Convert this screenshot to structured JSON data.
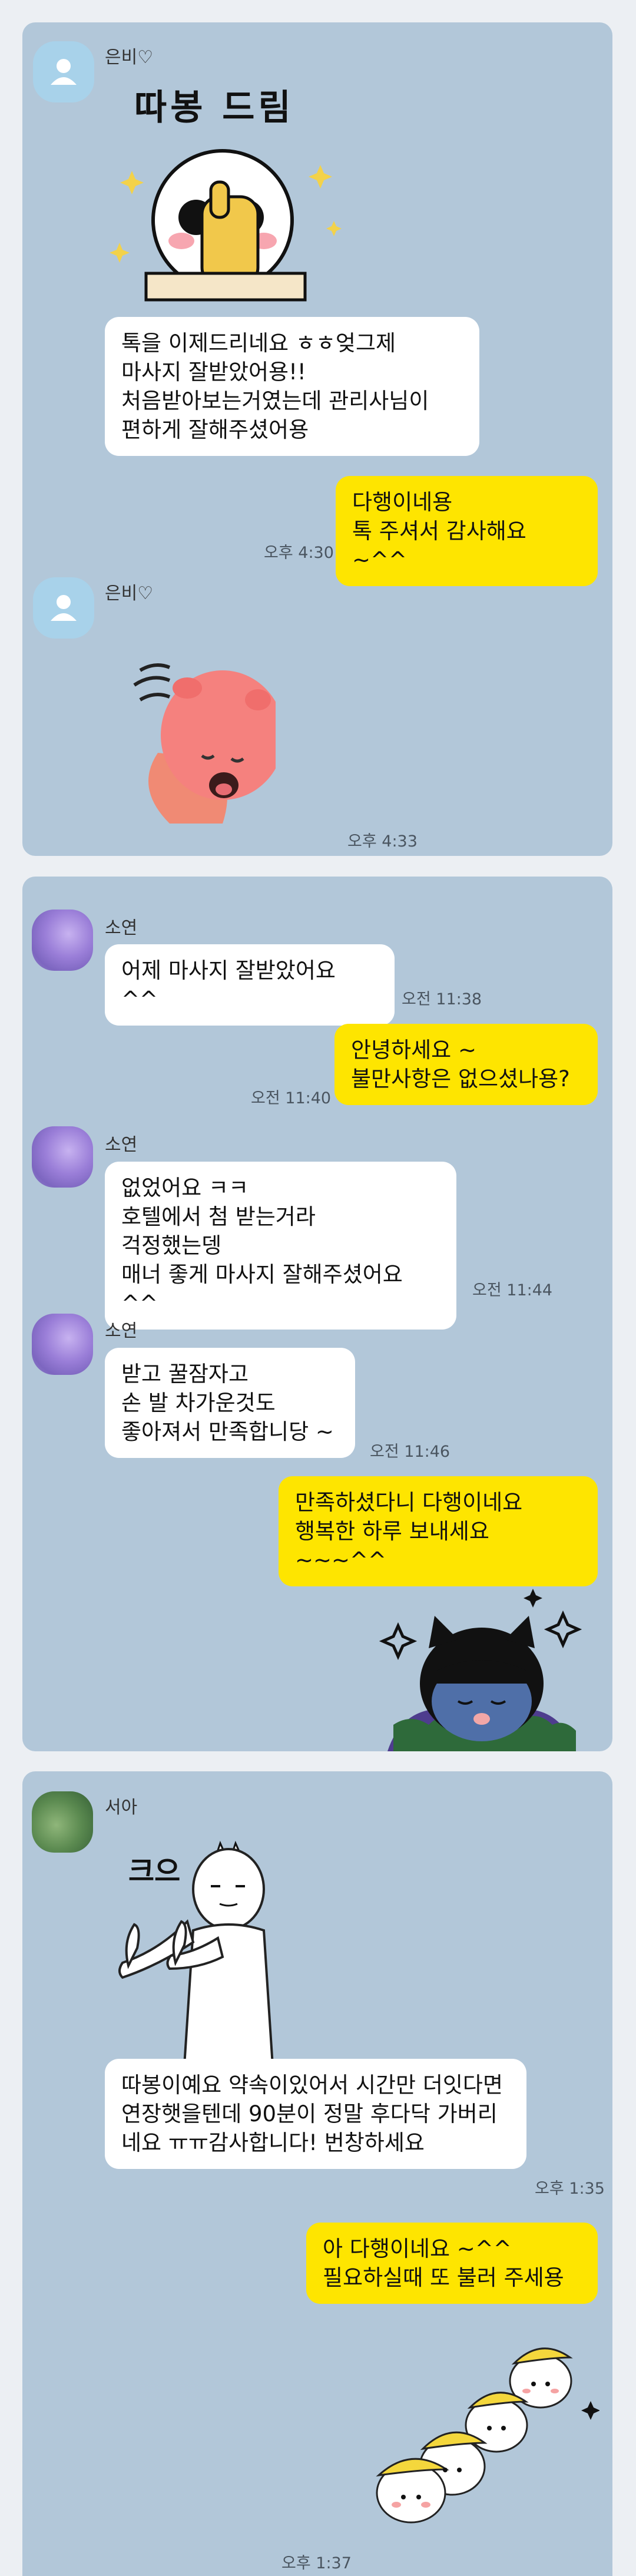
{
  "colors": {
    "chat_bg": "#b2c7d9",
    "my_bubble": "#fee500",
    "their_bubble": "#ffffff",
    "page_bg": "#eceff3"
  },
  "chat1": {
    "name": "은비♡",
    "sticker1_text": "따봉 드림",
    "msg1": "톡을 이제드리네요 ㅎㅎ엊그제\n마사지 잘받았어용!!\n처음받아보는거였는데 관리사님이\n편하게 잘해주셨어용",
    "reply": "다행이네용\n톡 주셔서 감사해요 ~^^",
    "reply_time": "오후 4:30",
    "name2": "은비♡",
    "sticker2_time": "오후 4:33"
  },
  "chat2": {
    "name1": "소연",
    "msg1": "어제 마사지 잘받았어요 ^^",
    "time1": "오전 11:38",
    "reply1": "안녕하세요 ~\n불만사항은 없으셨나용?",
    "reply1_time": "오전 11:40",
    "name2": "소연",
    "msg2": "없었어요 ㅋㅋ\n호텔에서 첨 받는거라\n걱정했는뎅\n매너 좋게 마사지 잘해주셨어요 ^^",
    "time2": "오전 11:44",
    "name3": "소연",
    "msg3": "받고 꿀잠자고\n손 발 차가운것도\n좋아져서 만족합니당 ~",
    "time3": "오전 11:46",
    "reply2": "만족하셨다니 다행이네요\n행복한 하루 보내세요 ~~~^^"
  },
  "chat3": {
    "name": "서아",
    "sticker_text": "크으",
    "msg1": "따봉이예요 약속이있어서 시간만 더잇다면 연장햇을텐데 90분이 정말 후다닥 가버리네요 ㅠㅠ감사합니다! 번창하세요",
    "time1": "오후 1:35",
    "reply": "아 다행이네요 ~^^\n필요하실때 또 불러 주세용",
    "reply_time": "오후 1:37"
  }
}
